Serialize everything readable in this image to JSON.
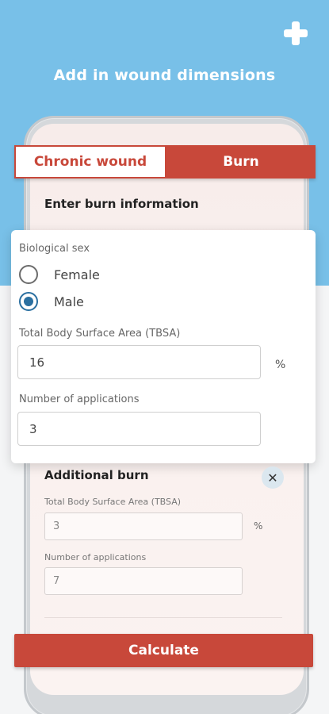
{
  "header": {
    "title": "Add in wound dimensions",
    "add_icon": "plus-icon"
  },
  "tabs": {
    "chronic_label": "Chronic wound",
    "burn_label": "Burn",
    "active": "Burn"
  },
  "burn_info": {
    "title": "Enter burn information",
    "sex_label": "Biological sex",
    "option_female": "Female",
    "option_male": "Male",
    "selected_sex": "Male",
    "tbsa_label": "Total Body Surface Area (TBSA)",
    "tbsa_value": "16",
    "tbsa_unit": "%",
    "applications_label": "Number of applications",
    "applications_value": "3"
  },
  "additional_burn": {
    "title": "Additional burn",
    "close_icon": "close-icon",
    "tbsa_label": "Total Body Surface Area (TBSA)",
    "tbsa_value": "3",
    "tbsa_unit": "%",
    "applications_label": "Number of applications",
    "applications_value": "7"
  },
  "actions": {
    "calculate_label": "Calculate"
  },
  "colors": {
    "brand_red": "#c8483a",
    "sky_blue": "#78c0e8",
    "radio_blue": "#2a6fa0"
  }
}
